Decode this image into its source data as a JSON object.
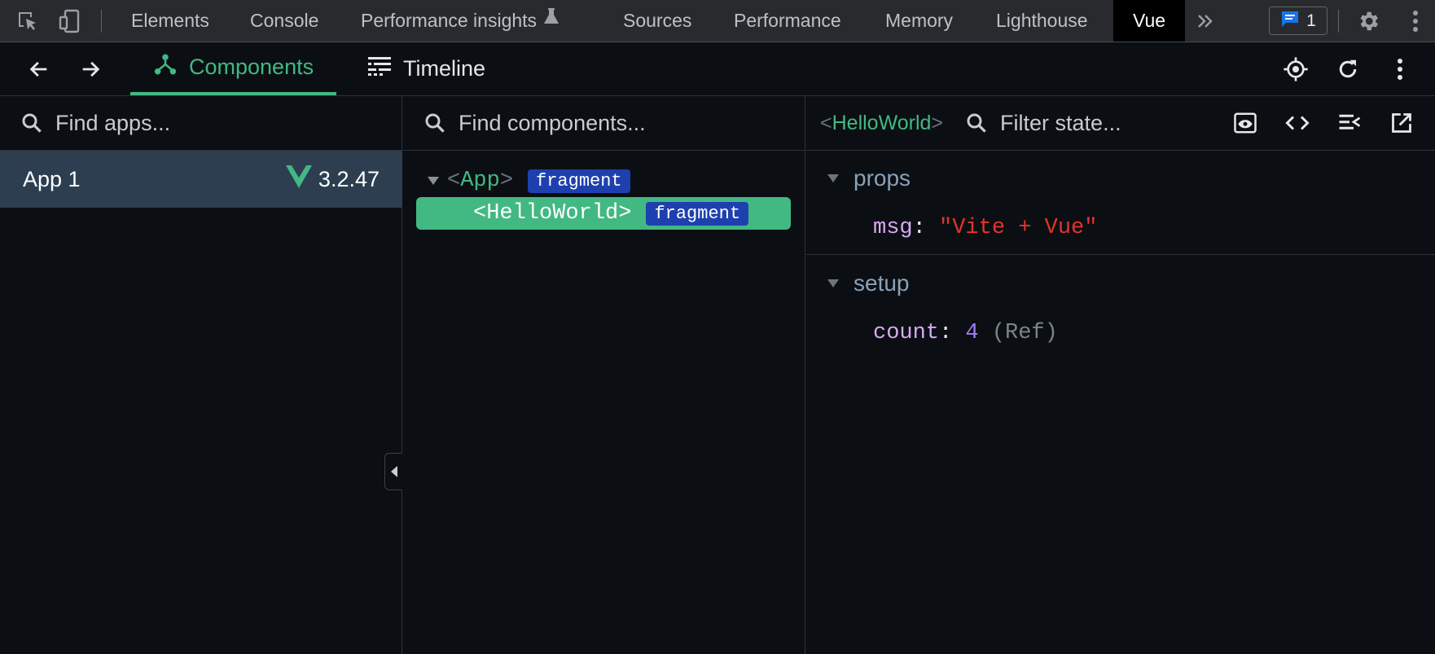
{
  "devtools": {
    "tabs": [
      "Elements",
      "Console",
      "Performance insights",
      "Sources",
      "Performance",
      "Memory",
      "Lighthouse",
      "Vue"
    ],
    "active_tab": "Vue",
    "issues_count": "1"
  },
  "vue_toolbar": {
    "tabs": [
      "Components",
      "Timeline"
    ],
    "active_tab": "Components"
  },
  "apps_pane": {
    "search_placeholder": "Find apps...",
    "apps": [
      {
        "name": "App 1",
        "version": "3.2.47",
        "selected": true
      }
    ]
  },
  "tree_pane": {
    "search_placeholder": "Find components...",
    "nodes": [
      {
        "open": "<",
        "name": "App",
        "close": ">",
        "badge": "fragment"
      },
      {
        "open": "<",
        "name": "HelloWorld",
        "close": ">",
        "badge": "fragment",
        "selected": true
      }
    ]
  },
  "state_pane": {
    "component": {
      "open": "<",
      "name": "HelloWorld",
      "close": ">"
    },
    "filter_placeholder": "Filter state...",
    "sections": [
      {
        "title": "props",
        "entries": [
          {
            "key": "msg",
            "colon": ":",
            "value": "\"Vite + Vue\""
          }
        ]
      },
      {
        "title": "setup",
        "entries": [
          {
            "key": "count",
            "colon": ":",
            "value": "4",
            "annotation": "(Ref)"
          }
        ]
      }
    ]
  },
  "colors": {
    "vue_green": "#42b883",
    "app_row_bg": "#2c3e50",
    "fragment_badge": "#1e40af",
    "string_value": "#e5332a",
    "number_value": "#9d7cf7",
    "key": "#d8a9f0"
  }
}
